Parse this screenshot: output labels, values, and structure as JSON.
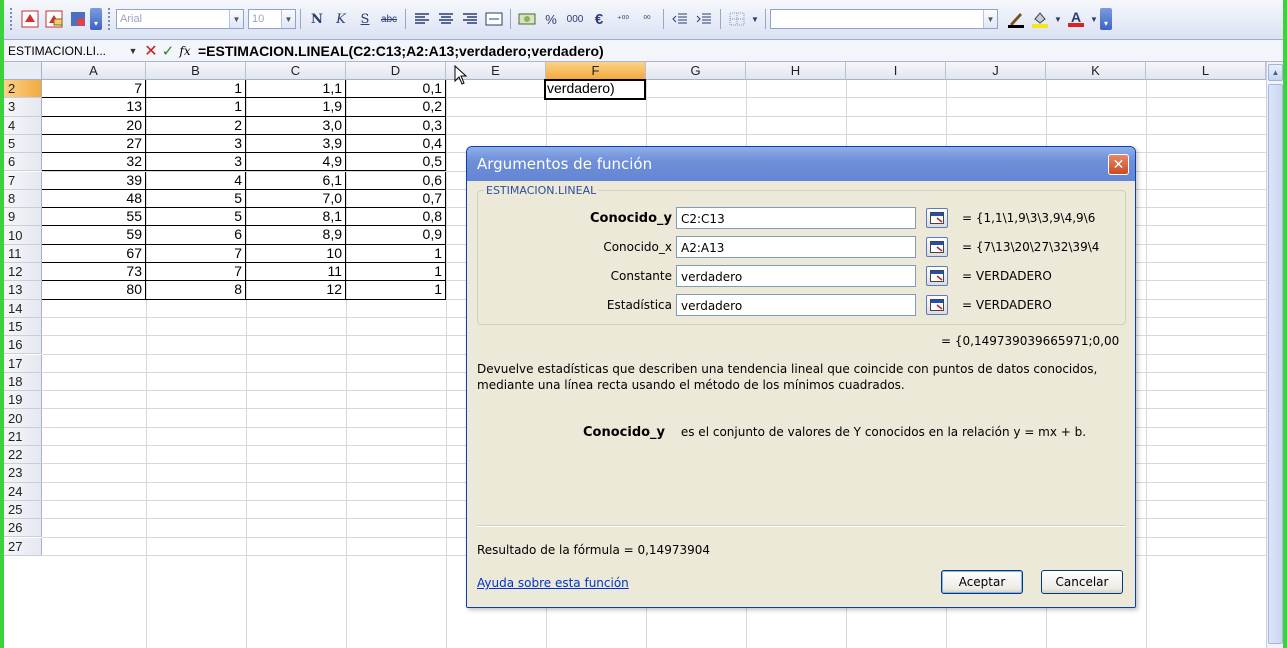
{
  "toolbar": {
    "font_name": "Arial",
    "font_size": "10",
    "bold_label": "N",
    "italic_label": "K",
    "underline_label": "S",
    "percent_label": "%",
    "thousands_label": "000",
    "euro_label": "€",
    "inc_decimal_label": "⁺⁰⁰",
    "dec_decimal_label": "⁰⁰",
    "font_color_letter": "A",
    "font_color": "#e02020",
    "highlight_color": "#f5e71b"
  },
  "formula_bar": {
    "name_box": "ESTIMACION.LI...",
    "formula": "=ESTIMACION.LINEAL(C2:C13;A2:A13;verdadero;verdadero)"
  },
  "grid": {
    "columns": [
      "A",
      "B",
      "C",
      "D",
      "E",
      "F",
      "G",
      "H",
      "I",
      "J",
      "K",
      "L"
    ],
    "selected_column": "F",
    "rows": [
      "2",
      "3",
      "4",
      "5",
      "6",
      "7",
      "8",
      "9",
      "10",
      "11",
      "12",
      "13",
      "14",
      "15",
      "16",
      "17",
      "18",
      "19",
      "20",
      "21",
      "22",
      "23",
      "24",
      "25",
      "26",
      "27"
    ],
    "selected_row": "2",
    "data": [
      [
        "7",
        "1",
        "1,1",
        "0,1"
      ],
      [
        "13",
        "1",
        "1,9",
        "0,2"
      ],
      [
        "20",
        "2",
        "3,0",
        "0,3"
      ],
      [
        "27",
        "3",
        "3,9",
        "0,4"
      ],
      [
        "32",
        "3",
        "4,9",
        "0,5"
      ],
      [
        "39",
        "4",
        "6,1",
        "0,6"
      ],
      [
        "48",
        "5",
        "7,0",
        "0,7"
      ],
      [
        "55",
        "5",
        "8,1",
        "0,8"
      ],
      [
        "59",
        "6",
        "8,9",
        "0,9"
      ],
      [
        "67",
        "7",
        "10",
        "1"
      ],
      [
        "73",
        "7",
        "11",
        "1"
      ],
      [
        "80",
        "8",
        "12",
        "1"
      ]
    ],
    "active_cell_text": "verdadero)"
  },
  "dialog": {
    "title": "Argumentos de función",
    "function_name": "ESTIMACION.LINEAL",
    "args": [
      {
        "label": "Conocido_y",
        "value": "C2:C13",
        "result": "=  {1,1\\1,9\\3\\3,9\\4,9\\6"
      },
      {
        "label": "Conocido_x",
        "value": "A2:A13",
        "result": "=  {7\\13\\20\\27\\32\\39\\4"
      },
      {
        "label": "Constante",
        "value": "verdadero",
        "result": "=  VERDADERO"
      },
      {
        "label": "Estadística",
        "value": "verdadero",
        "result": "=  VERDADERO"
      }
    ],
    "function_result": "=  {0,149739039665971;0,00",
    "description": "Devuelve estadísticas que describen una tendencia lineal que coincide con puntos de datos conocidos, mediante una línea recta usando el método de los mínimos cuadrados.",
    "arg_description_name": "Conocido_y",
    "arg_description_text": "es el conjunto de valores de Y conocidos en  la relación y = mx + b.",
    "formula_result": "Resultado de la fórmula =  0,14973904",
    "help_link": "Ayuda sobre esta función",
    "ok_label": "Aceptar",
    "cancel_label": "Cancelar",
    "close_label": "✕"
  }
}
